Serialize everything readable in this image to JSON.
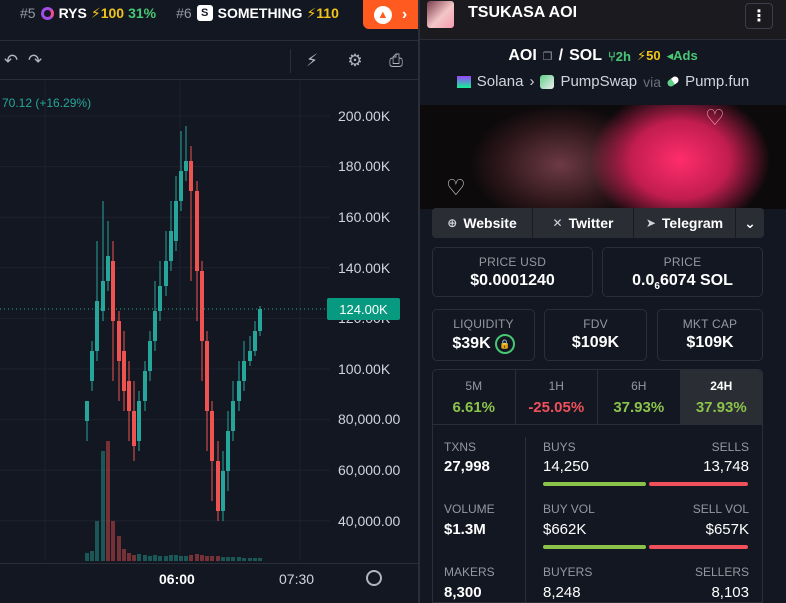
{
  "trending": [
    {
      "rank": "#5",
      "name": "RYS",
      "bolt": "⚡",
      "score": "100",
      "pct": "31%"
    },
    {
      "rank": "#6",
      "name": "SOMETHING",
      "bolt": "⚡",
      "score": "110"
    }
  ],
  "chart": {
    "price_change": "70.12 (+16.29%)",
    "current_price": "124.00K",
    "y_ticks": [
      "200.00K",
      "180.00K",
      "160.00K",
      "140.00K",
      "120.00K",
      "100.00K",
      "80,000.00",
      "60,000.00",
      "40,000.00"
    ],
    "x_ticks": [
      "06:00",
      "07:30"
    ]
  },
  "colors": {
    "up": "#26a69a",
    "down": "#ef5350",
    "accent": "#ff5a1f",
    "positive": "#8bc34a",
    "negative": "#f0505a"
  },
  "header": {
    "token_name": "TSUKASA AOI",
    "more": "⋮"
  },
  "pair": {
    "base": "AOI",
    "sep": "/",
    "quote": "SOL",
    "seed": "2h",
    "boost": "50",
    "ads": "Ads"
  },
  "chain": {
    "chain": "Solana",
    "dex": "PumpSwap",
    "via": "via",
    "launch": "Pump.fun"
  },
  "links": {
    "website": "Website",
    "twitter": "Twitter",
    "telegram": "Telegram"
  },
  "stats": {
    "price_usd_label": "PRICE USD",
    "price_usd": "$0.0001240",
    "price_label": "PRICE",
    "price_sol_prefix": "0.0",
    "price_sol_sub": "6",
    "price_sol_rest": "6074 SOL",
    "liquidity_label": "LIQUIDITY",
    "liquidity": "$39K",
    "fdv_label": "FDV",
    "fdv": "$109K",
    "mcap_label": "MKT CAP",
    "mcap": "$109K"
  },
  "timeframes": [
    {
      "label": "5M",
      "value": "6.61%",
      "sign": "pos"
    },
    {
      "label": "1H",
      "value": "-25.05%",
      "sign": "neg"
    },
    {
      "label": "6H",
      "value": "37.93%",
      "sign": "pos"
    },
    {
      "label": "24H",
      "value": "37.93%",
      "sign": "pos"
    }
  ],
  "txns": {
    "txns_label": "TXNS",
    "txns": "27,998",
    "buys_label": "BUYS",
    "buys": "14,250",
    "sells_label": "SELLS",
    "sells": "13,748",
    "volume_label": "VOLUME",
    "volume": "$1.3M",
    "buy_vol_label": "BUY VOL",
    "buy_vol": "$662K",
    "sell_vol_label": "SELL VOL",
    "sell_vol": "$657K",
    "makers_label": "MAKERS",
    "makers": "8,300",
    "buyers_label": "BUYERS",
    "buyers": "8,248",
    "sellers_label": "SELLERS",
    "sellers": "8,103"
  }
}
